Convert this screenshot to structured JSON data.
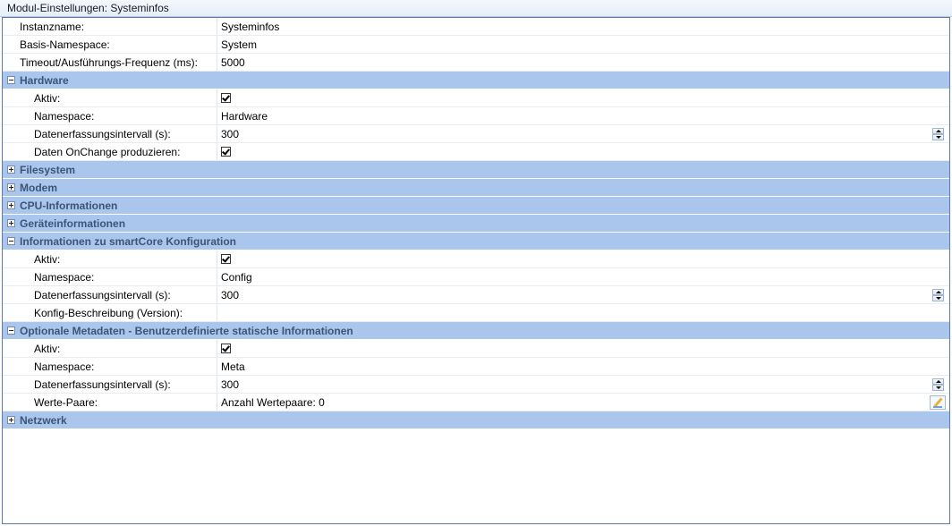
{
  "window": {
    "title": "Modul-Einstellungen: Systeminfos"
  },
  "top_rows": [
    {
      "label": "Instanzname:",
      "value": "Systeminfos"
    },
    {
      "label": "Basis-Namespace:",
      "value": "System"
    },
    {
      "label": "Timeout/Ausführungs-Frequenz (ms):",
      "value": "5000"
    }
  ],
  "categories": {
    "hardware": {
      "label": "Hardware",
      "aktiv_label": "Aktiv:",
      "aktiv": true,
      "namespace_label": "Namespace:",
      "namespace": "Hardware",
      "intervall_label": "Datenerfassungsintervall (s):",
      "intervall": "300",
      "onchange_label": "Daten OnChange produzieren:",
      "onchange": true
    },
    "filesystem": {
      "label": "Filesystem"
    },
    "modem": {
      "label": "Modem"
    },
    "cpu": {
      "label": "CPU-Informationen"
    },
    "geraete": {
      "label": "Geräteinformationen"
    },
    "smartcore": {
      "label": "Informationen zu smartCore Konfiguration",
      "aktiv_label": "Aktiv:",
      "aktiv": true,
      "namespace_label": "Namespace:",
      "namespace": "Config",
      "intervall_label": "Datenerfassungsintervall (s):",
      "intervall": "300",
      "beschreibung_label": "Konfig-Beschreibung (Version):",
      "beschreibung": ""
    },
    "meta": {
      "label": "Optionale Metadaten - Benutzerdefinierte statische Informationen",
      "aktiv_label": "Aktiv:",
      "aktiv": true,
      "namespace_label": "Namespace:",
      "namespace": "Meta",
      "intervall_label": "Datenerfassungsintervall (s):",
      "intervall": "300",
      "paare_label": "Werte-Paare:",
      "paare": "Anzahl Wertepaare: 0"
    },
    "netzwerk": {
      "label": "Netzwerk"
    }
  },
  "colors": {
    "category_bg": "#aac6ec",
    "category_text": "#3c5576",
    "border": "#5d7ba6"
  },
  "icons": {
    "expanded": "minus-box-icon",
    "collapsed": "plus-box-icon",
    "edit": "pencil-edit-icon"
  }
}
